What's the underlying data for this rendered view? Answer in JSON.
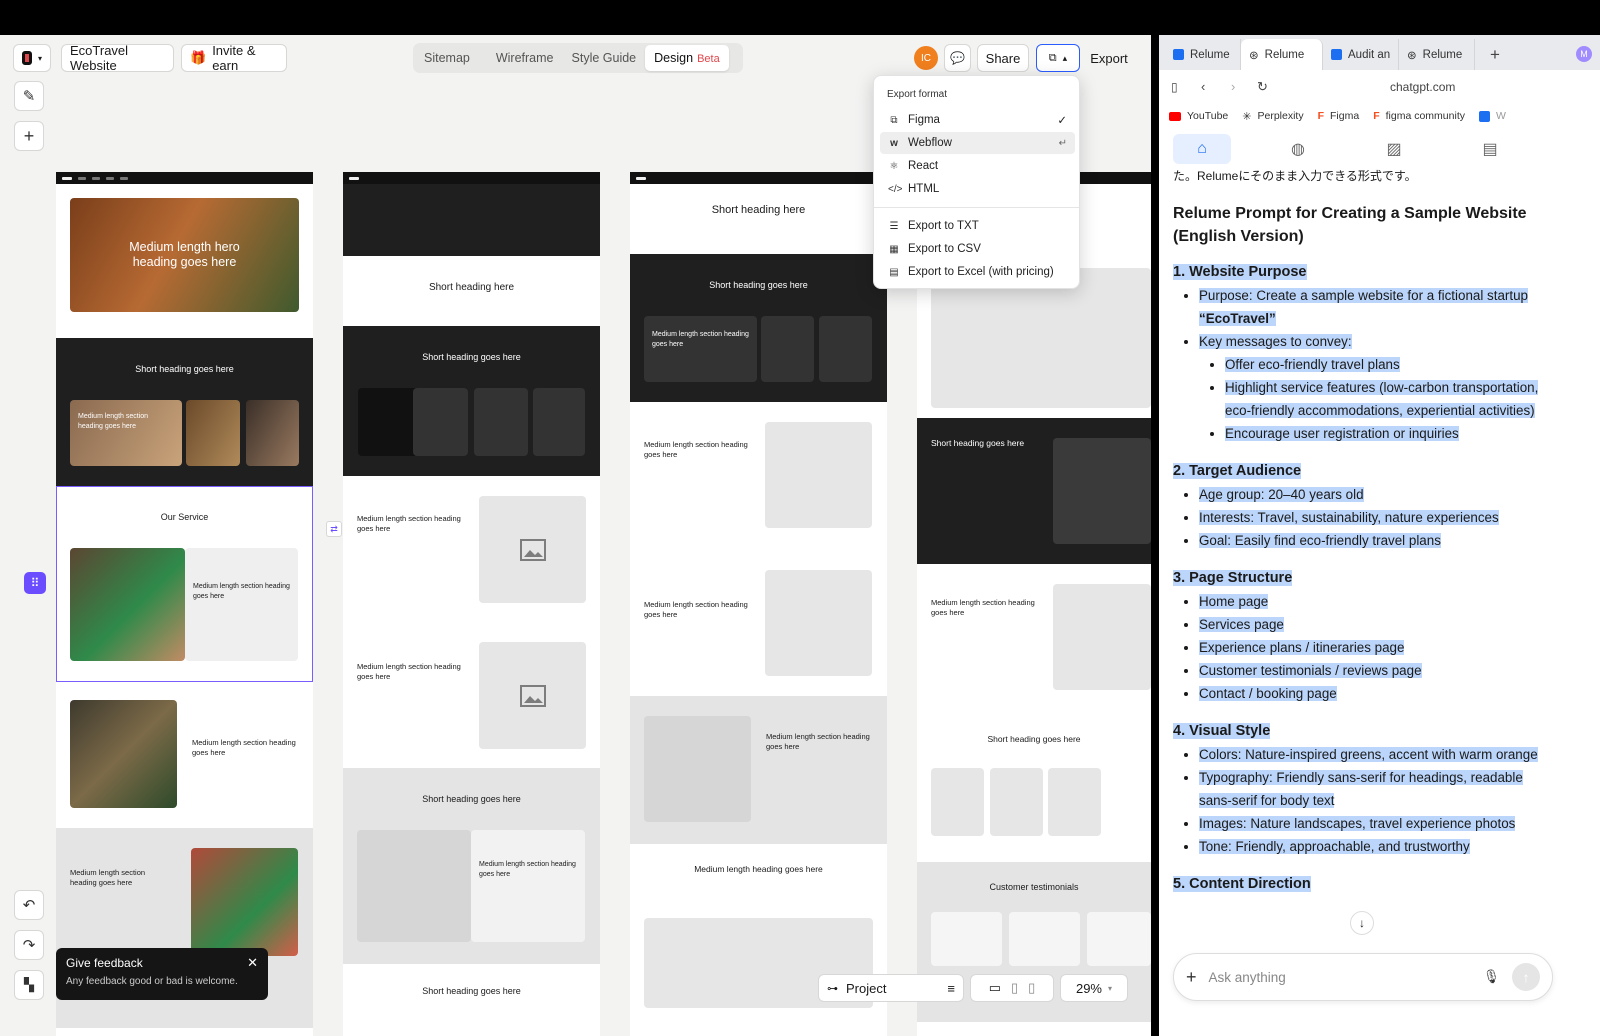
{
  "app": {
    "project_name": "EcoTravel Website",
    "invite_label": "Invite & earn",
    "nav_tabs": [
      {
        "label": "Sitemap"
      },
      {
        "label": "Wireframe"
      },
      {
        "label": "Style Guide"
      },
      {
        "label": "Design",
        "badge": "Beta"
      }
    ],
    "avatar_initials": "IC",
    "share_label": "Share",
    "export_label": "Export"
  },
  "export_menu": {
    "title": "Export format",
    "items": [
      {
        "label": "Figma",
        "icon": "figma-icon",
        "state": "checked"
      },
      {
        "label": "Webflow",
        "icon": "webflow-icon",
        "state": "highlighted"
      },
      {
        "label": "React",
        "icon": "react-icon"
      },
      {
        "label": "HTML",
        "icon": "code-icon"
      }
    ],
    "extra_items": [
      {
        "label": "Export to TXT",
        "icon": "txt-icon"
      },
      {
        "label": "Export to CSV",
        "icon": "table-icon"
      },
      {
        "label": "Export to Excel (with pricing)",
        "icon": "sheet-icon"
      }
    ]
  },
  "wireframe": {
    "hero": "Medium length hero heading goes here",
    "short_heading": "Short heading goes here",
    "short_heading_alt": "Short heading here",
    "medium_section": "Medium length section heading goes here",
    "medium_heading": "Medium length heading goes here",
    "our_service": "Our Service",
    "testimonials": "Customer testimonials",
    "card_a": "Medium length section heading goes here",
    "card_b": "Short heading here"
  },
  "feedback": {
    "title": "Give feedback",
    "text": "Any feedback good or bad is welcome."
  },
  "bottombar": {
    "project_label": "Project",
    "zoom": "29%"
  },
  "browser": {
    "tabs": [
      {
        "label": "Relume",
        "icon": "relume-icon"
      },
      {
        "label": "Relume",
        "icon": "chatgpt-icon",
        "active": true
      },
      {
        "label": "Audit an",
        "icon": "bookmark-icon"
      },
      {
        "label": "Relume",
        "icon": "chatgpt-icon"
      }
    ],
    "profile_initial": "M",
    "url": "chatgpt.com",
    "bookmarks": [
      {
        "label": "YouTube",
        "color": "#ff0000"
      },
      {
        "label": "Perplexity",
        "color": "#1f1f1f"
      },
      {
        "label": "Figma",
        "color": "#f24e1e"
      },
      {
        "label": "figma community",
        "color": "#f24e1e"
      },
      {
        "label": "W",
        "color": "#1d6ff2"
      }
    ]
  },
  "chat": {
    "jp_line": "た。Relumeにそのまま入力できる形式です。",
    "title": "Relume Prompt for Creating a Sample Website (English Version)",
    "sections": [
      {
        "heading": "1. Website Purpose",
        "items": [
          "Purpose: Create a sample website for a fictional startup",
          "“EcoTravel”",
          "Key messages to convey:"
        ],
        "subitems": [
          "Offer eco-friendly travel plans",
          "Highlight service features (low-carbon transportation,",
          "eco-friendly accommodations, experiential activities)",
          "Encourage user registration or inquiries"
        ]
      },
      {
        "heading": "2. Target Audience",
        "items": [
          "Age group: 20–40 years old",
          "Interests: Travel, sustainability, nature experiences",
          "Goal: Easily find eco-friendly travel plans"
        ]
      },
      {
        "heading": "3. Page Structure",
        "items": [
          "Home page",
          "Services page",
          "Experience plans / itineraries page",
          "Customer testimonials / reviews page",
          "Contact / booking page"
        ]
      },
      {
        "heading": "4. Visual Style",
        "items": [
          "Colors: Nature-inspired greens, accent with warm orange",
          "Typography: Friendly sans-serif for headings, readable",
          "sans-serif for body text",
          "Images: Nature landscapes, travel experience photos",
          "Tone: Friendly, approachable, and trustworthy"
        ]
      }
    ],
    "next_heading": "5. Content Direction",
    "placeholder": "Ask anything"
  },
  "colors": {
    "accent_orange": "#f07f1e",
    "selection_blue": "#bcd6fb",
    "frame_purple": "#7b5cff",
    "beta_red": "#e0474c"
  }
}
